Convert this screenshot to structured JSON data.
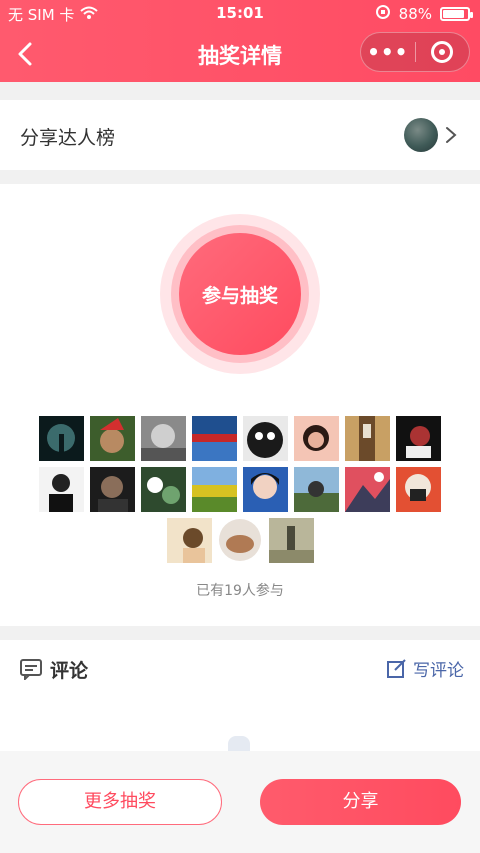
{
  "status_bar": {
    "carrier": "无 SIM 卡",
    "time": "15:01",
    "battery_percent": "88%",
    "battery_level": 0.88
  },
  "nav": {
    "title": "抽奖详情",
    "more_label": "•••"
  },
  "share_rank": {
    "label": "分享达人榜"
  },
  "draw": {
    "button_label": "参与抽奖"
  },
  "participants": {
    "count_text": "已有19人参与"
  },
  "comments": {
    "title": "评论",
    "write_label": "写评论"
  },
  "footer": {
    "more_label": "更多抽奖",
    "share_label": "分享"
  },
  "colors": {
    "brand": "#ff4b5f",
    "link": "#4a66a8"
  }
}
